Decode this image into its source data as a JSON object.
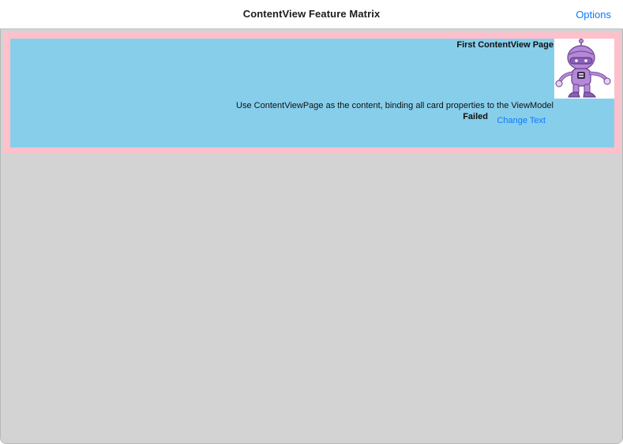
{
  "navbar": {
    "title": "ContentView Feature Matrix",
    "options_label": "Options"
  },
  "card": {
    "title": "First ContentView Page",
    "description": "Use ContentViewPage as the content, binding all card properties to the ViewModel",
    "status": "Failed",
    "action_label": "Change Text",
    "icon": "dotnet-bot-robot-icon"
  },
  "colors": {
    "accent": "#0a7aff",
    "card_border": "#ffc0cb",
    "card_background": "#87ceeb",
    "page_background": "#d3d3d3"
  }
}
